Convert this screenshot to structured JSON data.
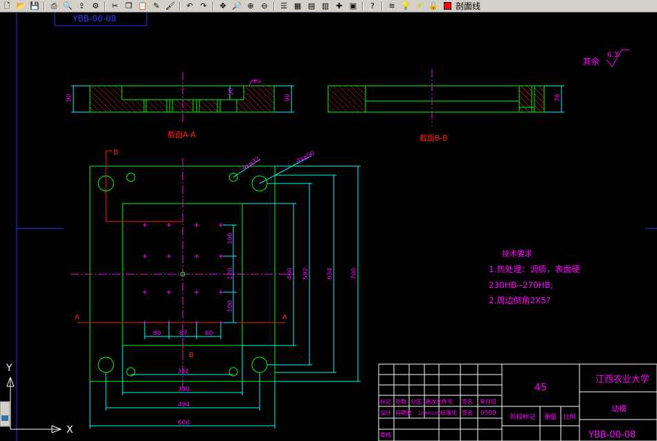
{
  "toolbar": {
    "icons": [
      "new-icon",
      "open-icon",
      "save-icon",
      "print-icon",
      "preview-icon",
      "publish-icon",
      "plot-icon",
      "cut-icon",
      "copy-icon",
      "paste-icon",
      "match-icon",
      "brush-icon",
      "undo-icon",
      "redo-icon",
      "pan-icon",
      "zoom-realtime-icon",
      "zoom-window-icon",
      "zoom-previous-icon",
      "properties-icon",
      "design-center-icon",
      "tool-palette-icon",
      "sheetset-icon",
      "markup-icon",
      "calculator-icon",
      "help-icon",
      "layer-manager-icon",
      "bulb-icon",
      "sun-icon",
      "lock-icon",
      "color-swatch-icon"
    ],
    "layer_name": "剖面线"
  },
  "drawing": {
    "top_label": "YBB-00-08",
    "section_a_title": "截面A-A",
    "section_b_title": "截面B-B",
    "roughness_rest": "其余",
    "roughness_value": "6.3",
    "surface_mark": "6.3",
    "marker_a": "A",
    "marker_b": "B",
    "dim_sec_a_left": "90",
    "dim_sec_a_inner": "50",
    "dim_sec_a_right": "90",
    "dim_sec_b_right": "78",
    "callout_small": "4xφ32",
    "callout_large": "4xφ50",
    "dim_100_a": "100",
    "dim_120": "120",
    "dim_100_b": "100",
    "dim_460": "460",
    "dim_592": "592",
    "dim_634": "634",
    "dim_700": "700",
    "dim_80_a": "80",
    "dim_87": "87",
    "dim_80_b": "80",
    "dim_332": "332",
    "dim_390": "390",
    "dim_494": "494",
    "dim_600": "600",
    "tech_title": "技术要求",
    "tech_line1": "1.热处理：调质，表面硬",
    "tech_line2": "230HB--270HB;",
    "tech_line3": "2.周边倒角2X5?"
  },
  "title_block": {
    "material": "45",
    "university": "江西农业大学",
    "part_name": "动模",
    "drawing_no": "YBB-00-08",
    "row1": [
      "标记",
      "处数",
      "分区",
      "更改文件号",
      "签名",
      "年月日"
    ],
    "row2": [
      "设计",
      "肖艳宏",
      "20090339",
      "标准化",
      "签名",
      "0509"
    ],
    "row3_label": "审核",
    "stage_label": "阶段标记",
    "weight_label": "重量",
    "scale_label": "比例"
  },
  "ucs": {
    "y_label": "Y",
    "x_label": "X"
  },
  "colors": {
    "background": "#000000",
    "outline": "#00ff00",
    "dimension": "#00ffff",
    "centerline": "#ff00ff",
    "hatch": "#ff0000",
    "text": "#ff00ff",
    "toolbar": "#d4d0c8"
  }
}
